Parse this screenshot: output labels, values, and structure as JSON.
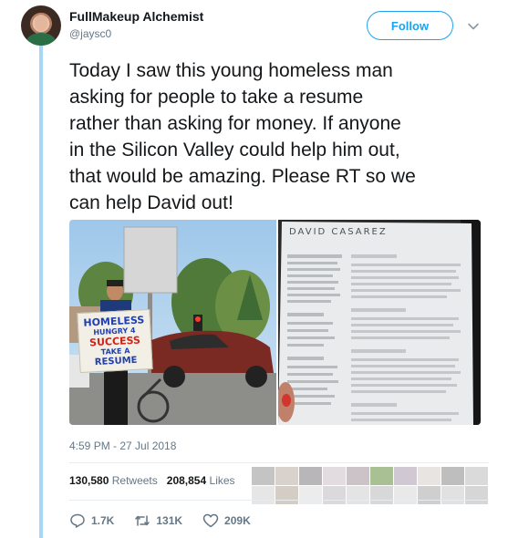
{
  "author": {
    "name": "FullMakeup Alchemist",
    "handle": "@jaysc0"
  },
  "follow_label": "Follow",
  "tweet": {
    "text": "Today I saw this young homeless man\nasking for people to take a resume\nrather than asking for money. If anyone\nin the Silicon Valley could help him out,\nthat would be amazing. Please RT so we\ncan help David out!",
    "timestamp": "4:59 PM - 27 Jul 2018"
  },
  "photos": {
    "sign_lines": [
      "HOMELESS",
      "HUNGRY 4",
      "SUCCESS",
      "TAKE A",
      "RESUME"
    ],
    "resume_name": "DAVID CASAREZ"
  },
  "stats": {
    "retweets_count": "130,580",
    "retweets_label": "Retweets",
    "likes_count": "208,854",
    "likes_label": "Likes"
  },
  "actions": {
    "replies": "1.7K",
    "retweets": "131K",
    "likes": "209K"
  },
  "colors": {
    "accent": "#1da1f2",
    "rail": "#a6d7f5",
    "muted": "#657786"
  }
}
